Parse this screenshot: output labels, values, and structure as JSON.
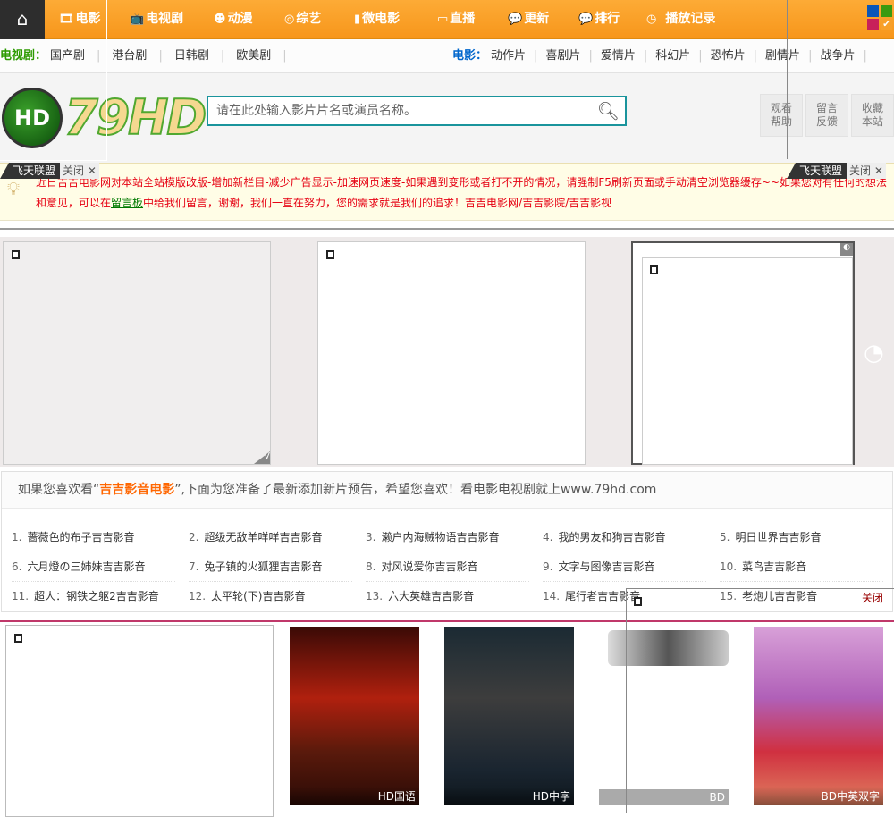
{
  "nav": {
    "items": [
      {
        "icon": "film-icon",
        "glyph": "🎞",
        "label": "电影"
      },
      {
        "icon": "tv-icon",
        "glyph": "📺",
        "label": "电视剧"
      },
      {
        "icon": "anime-icon",
        "glyph": "☻",
        "label": "动漫"
      },
      {
        "icon": "disc-icon",
        "glyph": "◎",
        "label": "综艺"
      },
      {
        "icon": "camera-icon",
        "glyph": "▮",
        "label": "微电影"
      },
      {
        "icon": "monitor-icon",
        "glyph": "▭",
        "label": "直播"
      },
      {
        "icon": "chat-icon",
        "glyph": "💬",
        "label": "更新"
      },
      {
        "icon": "chat-icon",
        "glyph": "💬",
        "label": "排行"
      },
      {
        "icon": "clock-icon",
        "glyph": "◷",
        "label": "播放记录"
      }
    ]
  },
  "subnav": {
    "tv_label": "电视剧：",
    "tv": [
      "国产剧",
      "港台剧",
      "日韩剧",
      "欧美剧"
    ],
    "movie_label": "电影：",
    "movie": [
      "动作片",
      "喜剧片",
      "爱情片",
      "科幻片",
      "恐怖片",
      "剧情片",
      "战争片"
    ]
  },
  "logo": {
    "text": "79HD",
    "badge": "HD"
  },
  "search": {
    "placeholder": "请在此处输入影片片名或演员名称。"
  },
  "header_buttons": [
    {
      "l1": "观看",
      "l2": "帮助"
    },
    {
      "l1": "留言",
      "l2": "反馈"
    },
    {
      "l1": "收藏",
      "l2": "本站"
    }
  ],
  "ad": {
    "label": "飞天联盟",
    "close": "关闭"
  },
  "notice": {
    "text1": "近日吉吉电影网对本站全站模版改版-增加新栏目-减少广告显示-加速网页速度-如果遇到变形或者打不开的情况，请强制F5刷新页面或手动清空浏览器缓存~~如果您对有任何的想法和意见，可以在",
    "link": "留言板",
    "text2": "中给我们留言，谢谢，我们一直在努力，您的需求就是我们的追求！吉吉电影网/吉吉影院/吉吉影视"
  },
  "preview": {
    "pre": "如果您喜欢看“",
    "highlight": "吉吉影音电影",
    "post": "”,下面为您准备了最新添加新片预告，希望您喜欢！看电影电视剧就上www.79hd.com",
    "close": "关闭",
    "items": [
      "蔷薇色的布子吉吉影音",
      "超级无敌羊咩咩吉吉影音",
      "濑户内海贼物语吉吉影音",
      "我的男友和狗吉吉影音",
      "明日世界吉吉影音",
      "六月燈の三姉妹吉吉影音",
      "兔子镇的火狐狸吉吉影音",
      "对风说爱你吉吉影音",
      "文字与图像吉吉影音",
      "菜鸟吉吉影音",
      "超人：钢铁之躯2吉吉影音",
      "太平轮(下)吉吉影音",
      "六大英雄吉吉影音",
      "尾行者吉吉影音",
      "老炮儿吉吉影音"
    ]
  },
  "posters": [
    {
      "tag": "HD国语",
      "bg": "linear-gradient(#3a0a06,#b0200e 40%,#5a1a0c 70%,#2a0a05)"
    },
    {
      "tag": "HD中字",
      "bg": "linear-gradient(#1b2a33,#3d3d3d 40%,#1a2530 80%,#0e161c)"
    },
    {
      "tag": "BD",
      "bg": "linear-gradient(#fff 0%,#fff 100%)"
    },
    {
      "tag": "BD中英双字",
      "bg": "linear-gradient(#d8a0d8,#b060b8 40%,#d03040 70%,#e08060)"
    }
  ],
  "colors": {
    "accent": "#f7a02a",
    "teal": "#1a949c",
    "green": "#2c9a00",
    "blue": "#0066cc"
  }
}
